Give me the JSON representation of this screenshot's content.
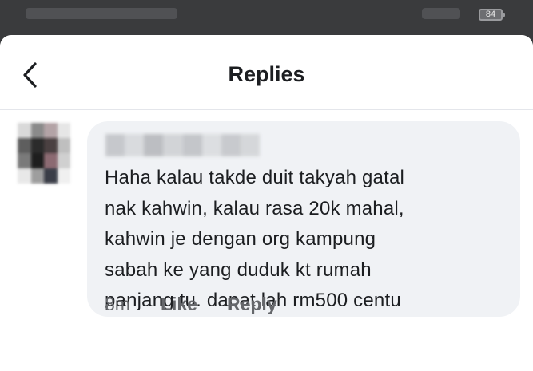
{
  "status_bar": {
    "battery": "84"
  },
  "header": {
    "title": "Replies"
  },
  "comment": {
    "text": "Haha kalau takde duit takyah gatal\nnak kahwin, kalau rasa 20k mahal,\nkahwin je dengan org kampung\nsabah ke yang duduk kt rumah\npanjang tu. dapat lah rm500 centu",
    "time": "8m",
    "like_label": "Like",
    "reply_label": "Reply"
  },
  "icons": {
    "back": "chevron-left-icon"
  },
  "colors": {
    "text_primary": "#1c1e21",
    "text_secondary": "#65676b",
    "bubble": "#f0f2f5",
    "status_bar": "#3a3b3d"
  }
}
